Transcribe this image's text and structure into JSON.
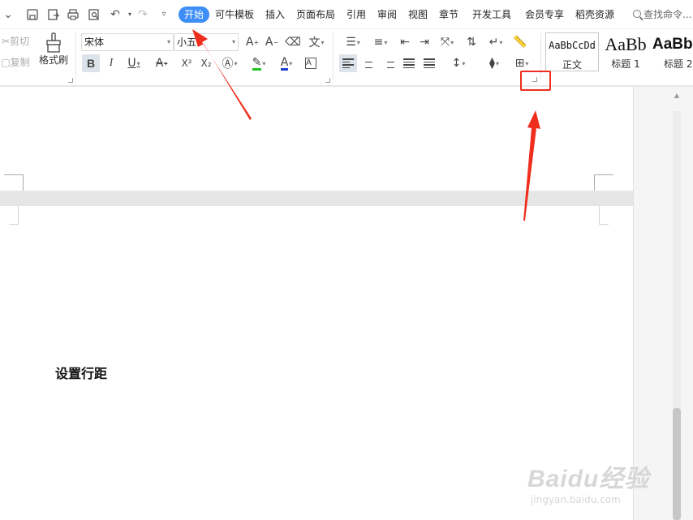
{
  "menubar": {
    "tabs": [
      "开始",
      "可牛模板",
      "插入",
      "页面布局",
      "引用",
      "审阅",
      "视图",
      "章节",
      "开发工具",
      "会员专享",
      "稻壳资源"
    ],
    "active_tab": "开始",
    "search_label": "查找命令..."
  },
  "ribbon": {
    "cut_label": "剪切",
    "copy_label": "复制",
    "format_painter_label": "格式刷",
    "font_name": "宋体",
    "font_size": "小五",
    "bold_label": "B",
    "italic_label": "I",
    "underline_label": "U",
    "superscript_label": "X²",
    "subscript_label": "X₂",
    "styles": [
      {
        "preview": "AaBbCcDd",
        "name": "正文"
      },
      {
        "preview": "AaBb",
        "name": "标题 1"
      },
      {
        "preview": "AaBb",
        "name": "标题 2"
      }
    ],
    "colors": {
      "highlight": "#22c322",
      "font_color": "#1f3fd1",
      "accent": "#3e8ef7"
    }
  },
  "document": {
    "body_text": "设置行距"
  },
  "annotation": {
    "color": "#f02e1e"
  },
  "watermark": {
    "brand": "Baidu经验",
    "url": "jingyan.baidu.com"
  },
  "icons": [
    "save-icon",
    "pdf-export-icon",
    "print-icon",
    "print-preview-icon",
    "undo-icon",
    "redo-icon",
    "customize-icon",
    "format-painter-icon"
  ]
}
